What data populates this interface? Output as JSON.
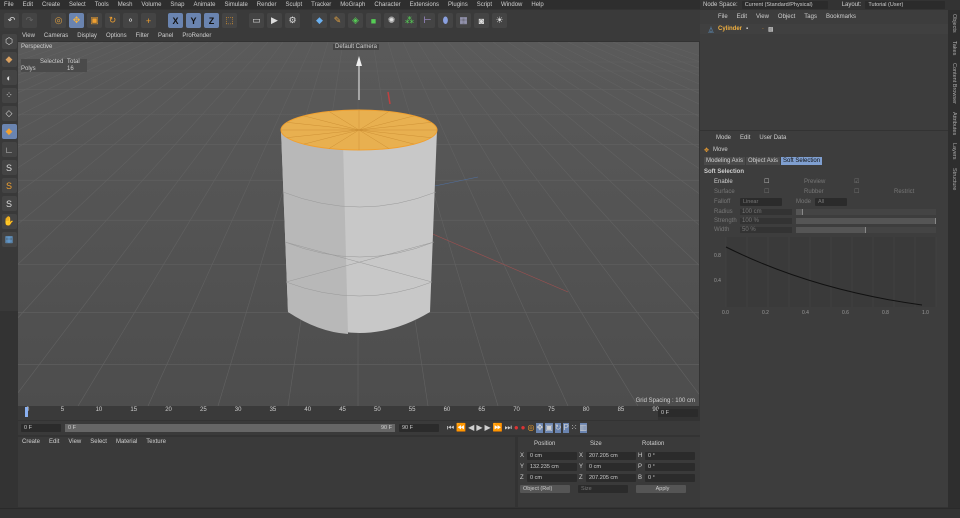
{
  "menubar": [
    "File",
    "Edit",
    "Create",
    "Select",
    "Tools",
    "Mesh",
    "Volume",
    "Snap",
    "Animate",
    "Simulate",
    "Render",
    "Sculpt",
    "Tracker",
    "MoGraph",
    "Character",
    "Extensions",
    "Plugins",
    "Script",
    "Window",
    "Help"
  ],
  "node_space": {
    "label": "Node Space:",
    "value": "Current (Standard/Physical)"
  },
  "layout": {
    "label": "Layout:",
    "value": "Tutorial (User)"
  },
  "toolbar": {
    "axes": [
      "X",
      "Y",
      "Z"
    ]
  },
  "viewport": {
    "menu": [
      "View",
      "Cameras",
      "Display",
      "Options",
      "Filter",
      "Panel",
      "ProRender"
    ],
    "name": "Perspective",
    "camera": "Default Camera",
    "stats_headers": [
      "Selected",
      "Total"
    ],
    "stats_row_label": "Polys",
    "stats_total": "16",
    "grid_spacing": "Grid Spacing : 100 cm"
  },
  "objects": {
    "menu": [
      "File",
      "Edit",
      "View",
      "Object",
      "Tags",
      "Bookmarks"
    ],
    "items": [
      {
        "name": "Cylinder"
      }
    ]
  },
  "right_tabs": [
    "Objects",
    "Takes",
    "Content Browser",
    "Attributes",
    "Layers",
    "Structure"
  ],
  "attributes": {
    "menu": [
      "Mode",
      "Edit",
      "User Data"
    ],
    "tool": "Move",
    "tabs": [
      "Modeling Axis",
      "Object Axis",
      "Soft Selection"
    ],
    "active_tab": "Soft Selection",
    "section": "Soft Selection",
    "enable": "Enable",
    "preview": "Preview",
    "surface": "Surface",
    "rubber": "Rubber",
    "restrict": "Restrict",
    "falloff_label": "Falloff",
    "falloff": "Linear",
    "mode_label": "Mode",
    "mode": "All",
    "radius_label": "Radius",
    "radius": "100 cm",
    "strength_label": "Strength",
    "strength": "100 %",
    "width_label": "Width",
    "width": "50 %",
    "graph": {
      "y_ticks": [
        "0.8",
        "0.4"
      ],
      "x_ticks": [
        "0.0",
        "0.2",
        "0.4",
        "0.6",
        "0.8",
        "1.0"
      ]
    }
  },
  "timeline": {
    "ticks": [
      "0",
      "5",
      "10",
      "15",
      "20",
      "25",
      "30",
      "35",
      "40",
      "45",
      "50",
      "55",
      "60",
      "65",
      "70",
      "75",
      "80",
      "85",
      "90"
    ],
    "current": "0 F",
    "start": "0 F",
    "range_start": "0 F",
    "range_end": "90 F",
    "end": "90 F"
  },
  "materials": {
    "menu": [
      "Create",
      "Edit",
      "View",
      "Select",
      "Material",
      "Texture"
    ]
  },
  "coords": {
    "headers": [
      "Position",
      "Size",
      "Rotation"
    ],
    "rows": [
      {
        "a": "X",
        "p": "0 cm",
        "b": "X",
        "s": "207.205 cm",
        "c": "H",
        "r": "0 °"
      },
      {
        "a": "Y",
        "p": "132.235 cm",
        "b": "Y",
        "s": "0 cm",
        "c": "P",
        "r": "0 °"
      },
      {
        "a": "Z",
        "p": "0 cm",
        "b": "Z",
        "s": "207.205 cm",
        "c": "B",
        "r": "0 °"
      }
    ],
    "mode": "Object (Rel)",
    "size_mode": "Size",
    "apply": "Apply"
  }
}
